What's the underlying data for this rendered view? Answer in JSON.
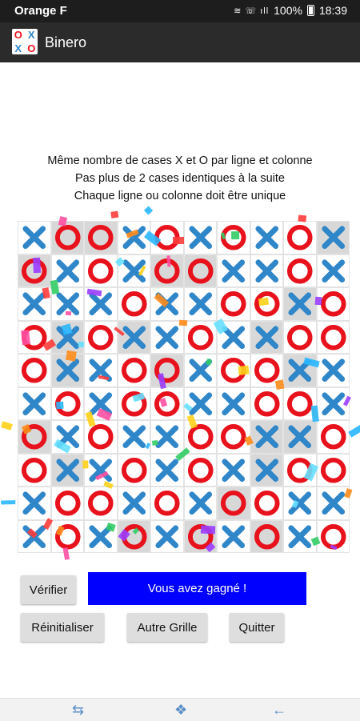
{
  "status_bar": {
    "carrier": "Orange F",
    "signal_icons": "≋ ☏ ıll",
    "battery": "100%",
    "time": "18:39"
  },
  "app_bar": {
    "title": "Binero",
    "logo_cells": [
      "O",
      "X",
      "X",
      "O"
    ]
  },
  "rules": [
    "Même nombre de cases X et O par ligne et colonne",
    "Pas plus de 2 cases identiques à la suite",
    "Chaque ligne ou colonne doit être unique"
  ],
  "colors": {
    "x": "#2f86c8",
    "o": "#e8121c",
    "fixed_cell": "#d8d8d8",
    "message_bg": "#0000ff"
  },
  "board": {
    "rows": [
      [
        "X",
        "O",
        "O",
        "X",
        "O",
        "X",
        "O",
        "X",
        "O",
        "X"
      ],
      [
        "O",
        "X",
        "O",
        "X",
        "O",
        "O",
        "X",
        "X",
        "O",
        "X"
      ],
      [
        "X",
        "X",
        "X",
        "O",
        "X",
        "X",
        "O",
        "O",
        "X",
        "O"
      ],
      [
        "O",
        "X",
        "O",
        "X",
        "X",
        "O",
        "X",
        "X",
        "O",
        "O"
      ],
      [
        "O",
        "X",
        "X",
        "O",
        "O",
        "X",
        "O",
        "O",
        "X",
        "X"
      ],
      [
        "X",
        "O",
        "X",
        "O",
        "O",
        "X",
        "X",
        "O",
        "O",
        "X"
      ],
      [
        "O",
        "X",
        "O",
        "X",
        "X",
        "O",
        "O",
        "X",
        "X",
        "O"
      ],
      [
        "O",
        "X",
        "X",
        "O",
        "X",
        "O",
        "X",
        "X",
        "O",
        "O"
      ],
      [
        "X",
        "O",
        "O",
        "X",
        "O",
        "X",
        "O",
        "O",
        "X",
        "X"
      ],
      [
        "X",
        "O",
        "X",
        "O",
        "X",
        "O",
        "X",
        "O",
        "X",
        "O"
      ]
    ],
    "fixed": [
      [
        0,
        1
      ],
      [
        0,
        2
      ],
      [
        0,
        9
      ],
      [
        1,
        0
      ],
      [
        1,
        4
      ],
      [
        1,
        5
      ],
      [
        2,
        8
      ],
      [
        3,
        1
      ],
      [
        3,
        3
      ],
      [
        3,
        7
      ],
      [
        4,
        1
      ],
      [
        4,
        4
      ],
      [
        4,
        8
      ],
      [
        6,
        0
      ],
      [
        6,
        7
      ],
      [
        6,
        8
      ],
      [
        7,
        1
      ],
      [
        7,
        7
      ],
      [
        8,
        6
      ],
      [
        9,
        3
      ],
      [
        9,
        5
      ],
      [
        9,
        7
      ]
    ]
  },
  "buttons": {
    "verify": "Vérifier",
    "reset": "Réinitialiser",
    "other_grid": "Autre Grille",
    "quit": "Quitter"
  },
  "message": "Vous avez gagné !",
  "confetti_colors": [
    "#ff3b3b",
    "#ffd21a",
    "#33cc66",
    "#2ab7ff",
    "#9b3dff",
    "#ff8c1a",
    "#ff4fa3",
    "#66e0ff"
  ],
  "nav_bar": {
    "recent_icon": "⇆",
    "home_icon": "❖",
    "back_icon": "←"
  }
}
